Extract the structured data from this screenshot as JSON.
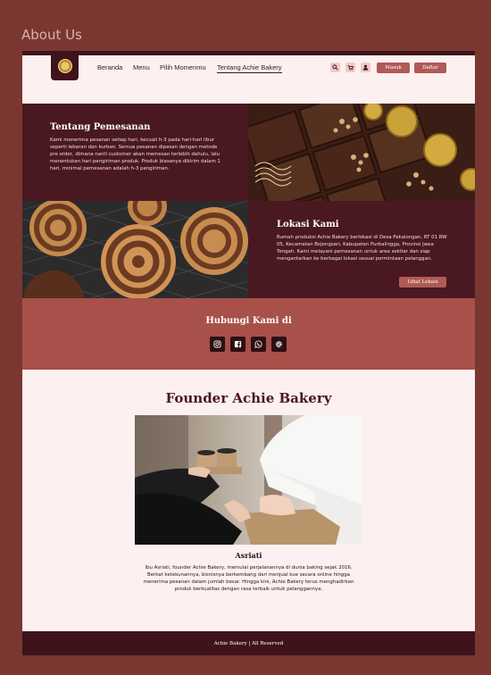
{
  "outer": {
    "title": "About Us"
  },
  "nav": {
    "links": [
      "Beranda",
      "Menu",
      "Pilih Momenmu",
      "Tentang Achie Bakery"
    ],
    "login_label": "Masuk",
    "register_label": "Daftar"
  },
  "ordering": {
    "title": "Tentang Pemesanan",
    "body": "Kami menerima pesanan setiap hari, kecuali h-3 pada hari-hari libur seperti lebaran dan kurban. Semua pesanan dipesan dengan metode pre order, dimana nanti customer akan memesan terlebih dahulu, lalu menentukan hari pengiriman produk. Produk biasanya dikirim dalam 1 hari, minimal pemesanan adalah h-3 pengiriman."
  },
  "location": {
    "title": "Lokasi Kami",
    "body": "Rumah produksi Achie Bakery berlokasi di Desa Pekalongan, RT 01 RW 05, Kecamatan Bojongsari, Kabupaten Purbalingga, Provinsi Jawa Tengah. Kami melayani pemesanan untuk area sekitar dan siap mengantarkan ke berbagai lokasi sesuai permintaan pelanggan.",
    "button_label": "Lihat Lokasi"
  },
  "contact": {
    "title": "Hubungi Kami di",
    "icons": [
      "instagram-icon",
      "facebook-icon",
      "whatsapp-icon",
      "email-icon"
    ]
  },
  "founder": {
    "heading": "Founder Achie Bakery",
    "name": "Asriati",
    "bio": "Ibu Asriati, founder Achie Bakery, memulai perjalanannya di dunia baking sejak 2016. Berkat ketekunannya, bisnisnya berkembang dari menjual kue secara online hingga menerima pesanan dalam jumlah besar. Hingga kini, Achie Bakery terus menghadirkan produk berkualitas dengan rasa terbaik untuk pelanggannya."
  },
  "footer": {
    "text": "Achie Bakery | All Reserved"
  },
  "colors": {
    "maroon": "#4a1820",
    "rose": "#a8504a",
    "button": "#b05a55",
    "background": "#fdf0f0"
  }
}
